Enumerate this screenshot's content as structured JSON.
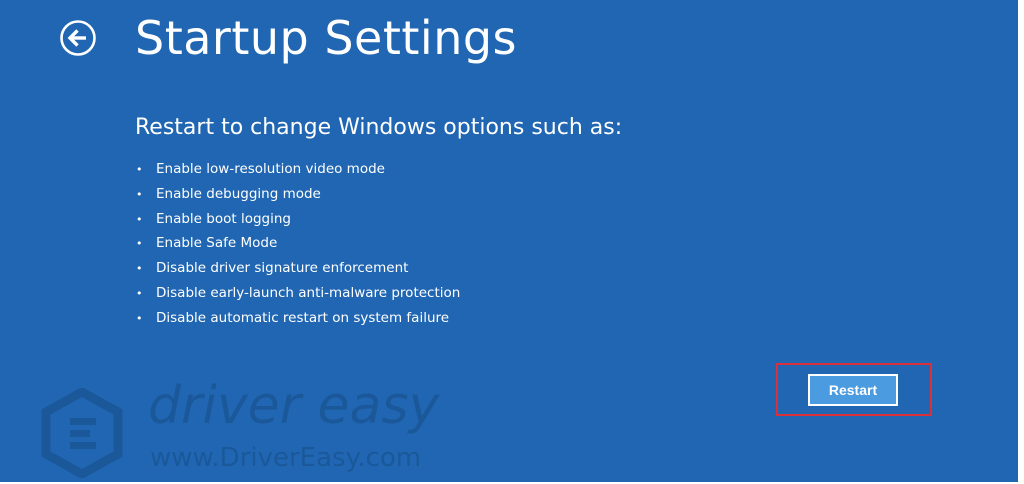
{
  "page": {
    "title": "Startup Settings",
    "subtitle": "Restart to change Windows options such as:"
  },
  "options": [
    "Enable low-resolution video mode",
    "Enable debugging mode",
    "Enable boot logging",
    "Enable Safe Mode",
    "Disable driver signature enforcement",
    "Disable early-launch anti-malware protection",
    "Disable automatic restart on system failure"
  ],
  "bullet": "•",
  "buttons": {
    "restart_label": "Restart"
  },
  "icons": {
    "back": "back-arrow-circle-icon"
  },
  "watermark": {
    "brand": "driver easy",
    "url": "www.DriverEasy.com"
  },
  "colors": {
    "background": "#2066b2",
    "text": "#ffffff",
    "button": "#4b9be0",
    "highlight": "#d9303a"
  }
}
